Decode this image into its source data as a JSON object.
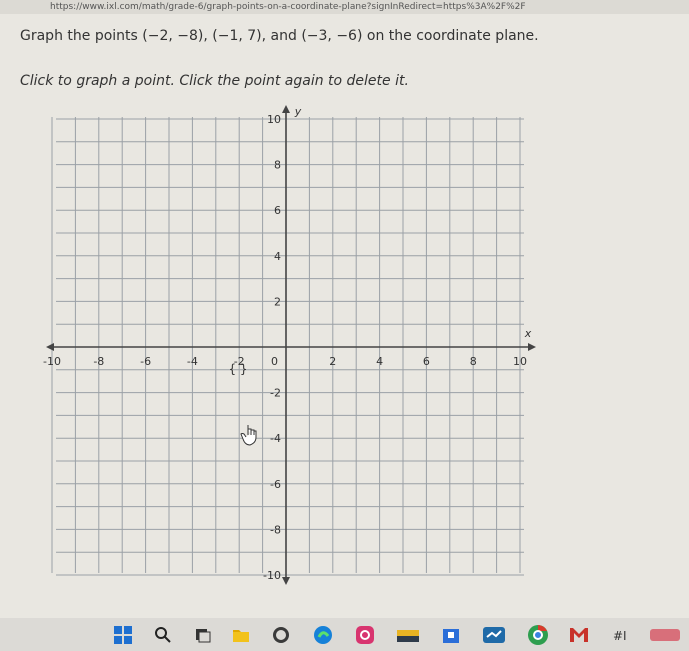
{
  "browser": {
    "url": "https://www.ixl.com/math/grade-6/graph-points-on-a-coordinate-plane?signInRedirect=https%3A%2F%2F"
  },
  "question": {
    "text": "Graph the points (−2, −8), (−1, 7), and (−3, −6) on the coordinate plane.",
    "instruction": "Click to graph a point. Click the point again to delete it."
  },
  "plane": {
    "x_axis_label": "x",
    "y_axis_label": "y",
    "x_ticks": [
      "-10",
      "-8",
      "-6",
      "-4",
      "-2",
      "2",
      "4",
      "6",
      "8",
      "10"
    ],
    "y_ticks": [
      "10",
      "8",
      "6",
      "4",
      "2",
      "-2",
      "-4",
      "-6",
      "-8",
      "-10"
    ],
    "origin_label": "0",
    "x_range": [
      -10,
      10
    ],
    "y_range": [
      -10,
      10
    ],
    "grid": true,
    "plotted_points": []
  },
  "taskbar": {
    "icons": [
      "start-icon",
      "search-icon",
      "task-view-icon",
      "file-explorer-icon",
      "chat-icon",
      "edge-icon",
      "instagram-icon",
      "folder-icon",
      "store-icon",
      "app-icon",
      "chrome-icon",
      "mail-icon",
      "app2-icon",
      "tray-icon"
    ]
  },
  "colors": {
    "grid": "#9aa0a6",
    "axis": "#444444",
    "background": "#e9e7e1"
  }
}
